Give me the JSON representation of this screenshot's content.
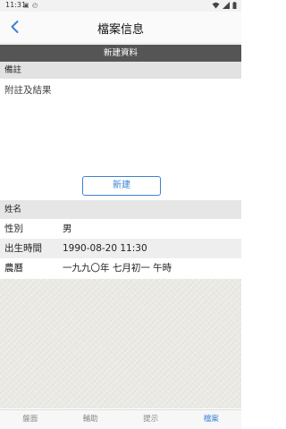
{
  "status": {
    "time": "11:31"
  },
  "header": {
    "title": "檔案信息",
    "back_icon": "chevron-left-icon"
  },
  "toolbar": {
    "label": "新建資料"
  },
  "remark": {
    "label": "備註",
    "placeholder": "附註及結果",
    "new_button": "新建"
  },
  "profile": {
    "name_label": "姓名",
    "gender_label": "性別",
    "gender": "男",
    "birth_label": "出生時間",
    "birth": "1990-08-20 11:30",
    "lunar_label": "農曆",
    "lunar": "一九九〇年 七月初一 午時"
  },
  "tabs": [
    {
      "label": "盤面"
    },
    {
      "label": "輔助"
    },
    {
      "label": "提示"
    },
    {
      "label": "檔案"
    }
  ],
  "colors": {
    "accent": "#3b82d6",
    "bar": "#555555"
  }
}
